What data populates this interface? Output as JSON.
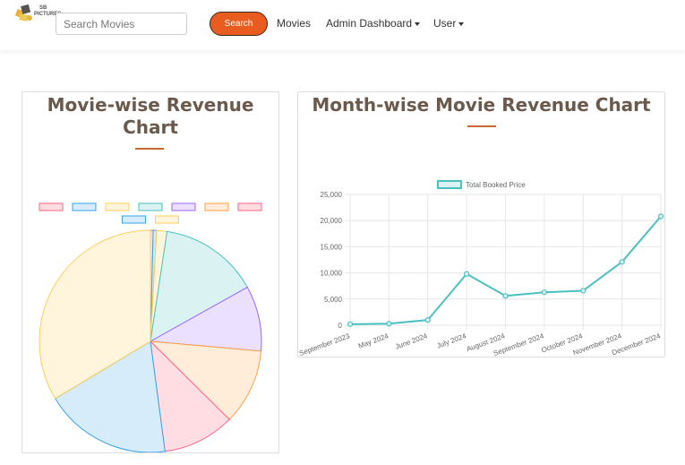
{
  "nav": {
    "logo_text_top": "SB",
    "logo_text_bottom": "PICTURES",
    "search_placeholder": "Search Movies",
    "search_button": "Search",
    "links": [
      "Movies",
      "Admin Dashboard",
      "User"
    ]
  },
  "left_card": {
    "title_line1": "Movie-wise Revenue",
    "title_line2": "Chart"
  },
  "right_card": {
    "title": "Month-wise Movie Revenue Chart"
  },
  "colors": {
    "accent": "#e85d1f",
    "title": "#6b5a4c",
    "line": "#4bc0c0"
  },
  "chart_data": [
    {
      "type": "pie",
      "slices": [
        {
          "value": 0.4,
          "fill": "#ffdde3",
          "stroke": "#ff6384"
        },
        {
          "value": 0.5,
          "fill": "#d6ecfb",
          "stroke": "#36a2eb"
        },
        {
          "value": 1.5,
          "fill": "#fff5dd",
          "stroke": "#ffcd56"
        },
        {
          "value": 14.5,
          "fill": "#dbf2f2",
          "stroke": "#4bc0c0"
        },
        {
          "value": 9.5,
          "fill": "#ebe0ff",
          "stroke": "#9966ff"
        },
        {
          "value": 11.0,
          "fill": "#ffecd9",
          "stroke": "#ff9f40"
        },
        {
          "value": 10.5,
          "fill": "#ffdde3",
          "stroke": "#ff6384"
        },
        {
          "value": 18.5,
          "fill": "#d6ecfb",
          "stroke": "#36a2eb"
        },
        {
          "value": 33.6,
          "fill": "#fff5dd",
          "stroke": "#ffcd56"
        }
      ]
    },
    {
      "type": "line",
      "series": [
        {
          "name": "Total Booked Price",
          "values": [
            200,
            300,
            1000,
            9800,
            5600,
            6300,
            6600,
            12100,
            20800
          ]
        }
      ],
      "categories": [
        "September 2023",
        "May 2024",
        "June 2024",
        "July 2024",
        "August 2024",
        "September 2024",
        "October 2024",
        "November 2024",
        "December 2024"
      ],
      "yticks": [
        "0",
        "5,000",
        "10,000",
        "15,000",
        "20,000",
        "25,000"
      ],
      "ylim": [
        0,
        25000
      ],
      "grid": true,
      "legend": "top"
    }
  ]
}
